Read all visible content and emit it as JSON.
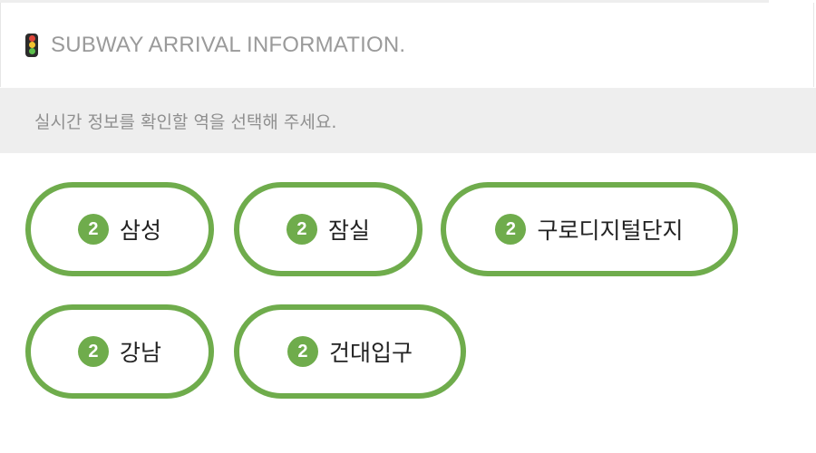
{
  "header": {
    "icon": "traffic-light-icon",
    "title": "SUBWAY ARRIVAL INFORMATION."
  },
  "subheader": {
    "text": "실시간 정보를 확인할 역을 선택해 주세요."
  },
  "colors": {
    "line2_green": "#6fac4c",
    "title_gray": "#9a9a9a",
    "subheader_bg": "#eeeeee"
  },
  "stations": [
    {
      "line": "2",
      "name": "삼성"
    },
    {
      "line": "2",
      "name": "잠실"
    },
    {
      "line": "2",
      "name": "구로디지털단지"
    },
    {
      "line": "2",
      "name": "강남"
    },
    {
      "line": "2",
      "name": "건대입구"
    }
  ]
}
